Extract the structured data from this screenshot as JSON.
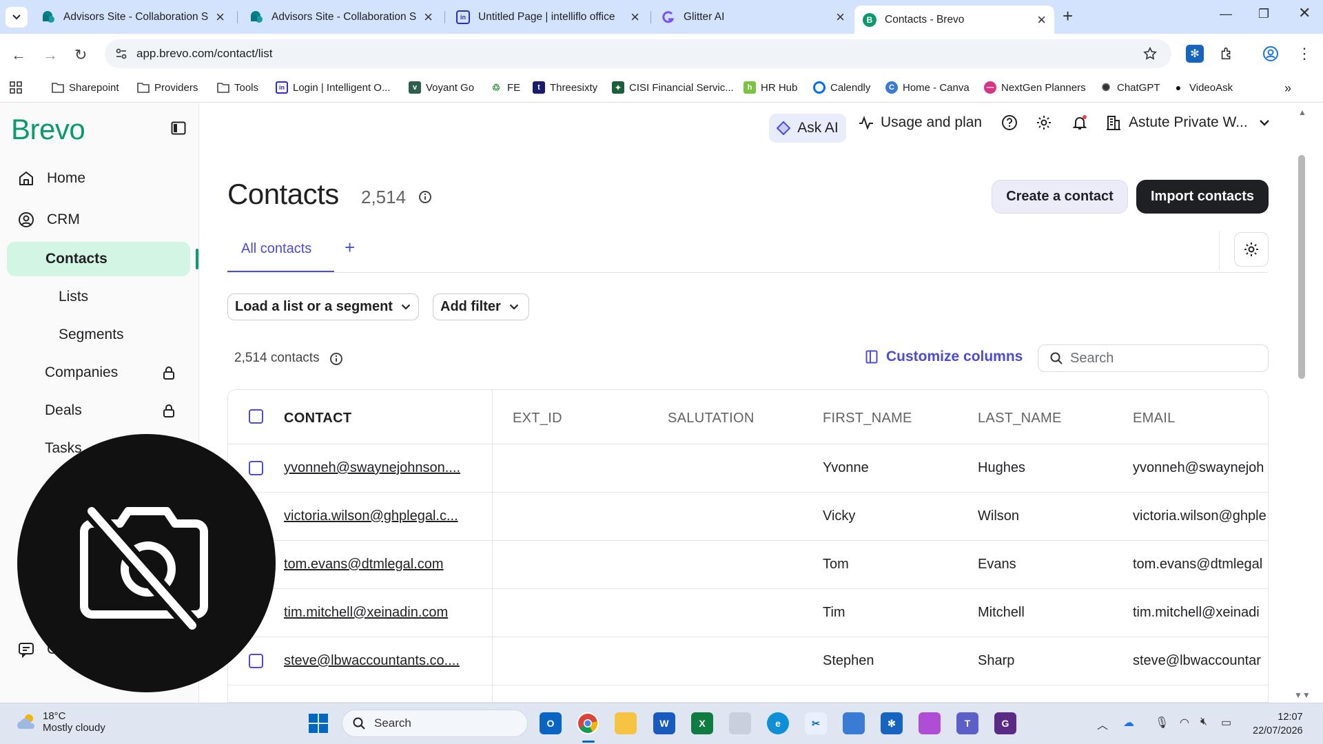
{
  "browser": {
    "tabs": [
      {
        "title": "Advisors Site - Collaboration Sit",
        "active": false
      },
      {
        "title": "Advisors Site - Collaboration Sit",
        "active": false
      },
      {
        "title": "Untitled Page | intelliflo office",
        "active": false
      },
      {
        "title": "Glitter AI",
        "active": false
      },
      {
        "title": "Contacts - Brevo",
        "active": true
      }
    ],
    "url": "app.brevo.com/contact/list",
    "bookmarks": [
      "Sharepoint",
      "Providers",
      "Tools",
      "Login | Intelligent O...",
      "Voyant Go",
      "FE",
      "Threesixty",
      "CISI Financial Servic...",
      "HR Hub",
      "Calendly",
      "Home - Canva",
      "NextGen Planners",
      "ChatGPT",
      "VideoAsk"
    ]
  },
  "sidebar": {
    "logo": "Brevo",
    "items": [
      {
        "label": "Home",
        "icon": "home-icon"
      },
      {
        "label": "CRM",
        "icon": "user-circle-icon"
      },
      {
        "label": "Contacts",
        "active": true
      },
      {
        "label": "Lists"
      },
      {
        "label": "Segments"
      },
      {
        "label": "Companies",
        "locked": true
      },
      {
        "label": "Deals",
        "locked": true
      },
      {
        "label": "Tasks"
      },
      {
        "label": "C",
        "icon": "chat-icon"
      }
    ]
  },
  "topbar": {
    "ask_ai": "Ask AI",
    "usage": "Usage and plan",
    "account": "Astute Private W..."
  },
  "page": {
    "title": "Contacts",
    "count": "2,514",
    "create_button": "Create a contact",
    "import_button": "Import contacts",
    "tab_all": "All contacts",
    "tab_add": "+",
    "load_list": "Load a list or a segment",
    "add_filter": "Add filter",
    "contacts_count": "2,514 contacts",
    "customize": "Customize columns",
    "search_placeholder": "Search"
  },
  "table": {
    "headers": [
      "CONTACT",
      "EXT_ID",
      "SALUTATION",
      "FIRST_NAME",
      "LAST_NAME",
      "EMAIL"
    ],
    "rows": [
      {
        "contact": "yvonneh@swaynejohnson....",
        "ext_id": "",
        "salutation": "",
        "first": "Yvonne",
        "last": "Hughes",
        "email": "yvonneh@swaynejoh"
      },
      {
        "contact": "victoria.wilson@ghplegal.c...",
        "ext_id": "",
        "salutation": "",
        "first": "Vicky",
        "last": "Wilson",
        "email": "victoria.wilson@ghple"
      },
      {
        "contact": "tom.evans@dtmlegal.com",
        "ext_id": "",
        "salutation": "",
        "first": "Tom",
        "last": "Evans",
        "email": "tom.evans@dtmlegal"
      },
      {
        "contact": "tim.mitchell@xeinadin.com",
        "ext_id": "",
        "salutation": "",
        "first": "Tim",
        "last": "Mitchell",
        "email": "tim.mitchell@xeinadi"
      },
      {
        "contact": "steve@lbwaccountants.co....",
        "ext_id": "",
        "salutation": "",
        "first": "Stephen",
        "last": "Sharp",
        "email": "steve@lbwaccountar"
      }
    ]
  },
  "taskbar": {
    "temperature": "18°C",
    "weather": "Mostly cloudy",
    "search": "Search",
    "time": "12:07",
    "date": "22/07/2026"
  },
  "colors": {
    "brand": "#0b996e",
    "accent": "#4a4bd6",
    "active_nav": "#d3f5e3"
  }
}
